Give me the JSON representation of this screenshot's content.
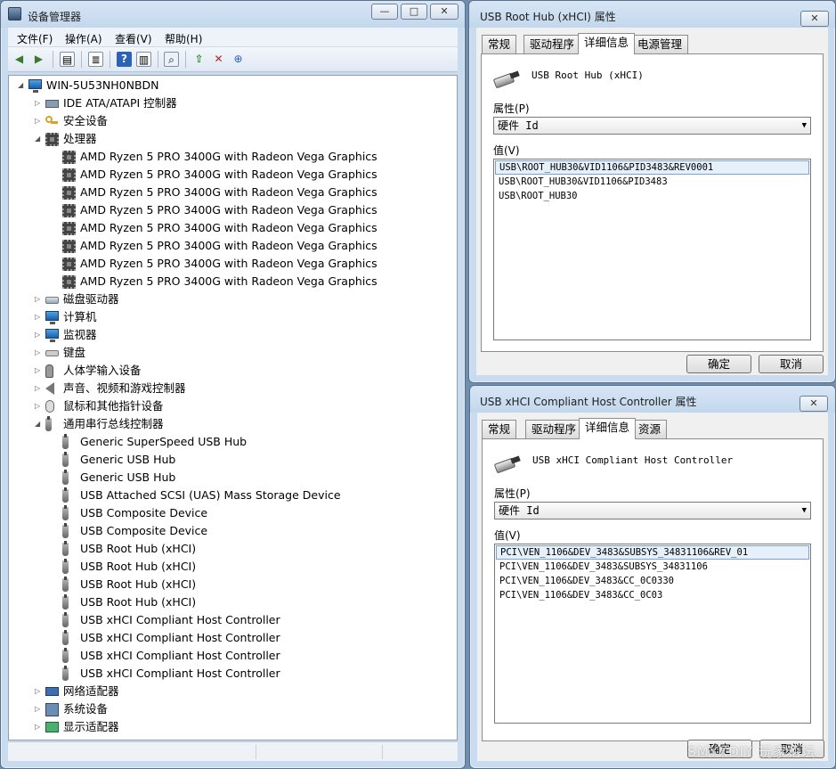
{
  "device_manager": {
    "title": "设备管理器",
    "caption_buttons": {
      "minimize": "—",
      "maximize": "□",
      "close": "✕"
    },
    "menu": [
      "文件(F)",
      "操作(A)",
      "查看(V)",
      "帮助(H)"
    ],
    "toolbar_icons": [
      "back-arrow-icon",
      "forward-arrow-icon",
      "show-hide-tree-icon",
      "properties-icon",
      "help-icon",
      "action-pane-icon",
      "scan-hardware-icon",
      "update-driver-icon",
      "uninstall-icon",
      "enable-device-icon"
    ],
    "tree": {
      "root": "WIN-5U53NH0NBDN",
      "categories": [
        {
          "label": "IDE ATA/ATAPI 控制器",
          "icon": "ide-controller-icon",
          "expanded": false,
          "children": []
        },
        {
          "label": "安全设备",
          "icon": "security-key-icon",
          "expanded": false,
          "children": []
        },
        {
          "label": "处理器",
          "icon": "processor-icon",
          "expanded": true,
          "children": [
            "AMD Ryzen 5 PRO 3400G with Radeon Vega Graphics",
            "AMD Ryzen 5 PRO 3400G with Radeon Vega Graphics",
            "AMD Ryzen 5 PRO 3400G with Radeon Vega Graphics",
            "AMD Ryzen 5 PRO 3400G with Radeon Vega Graphics",
            "AMD Ryzen 5 PRO 3400G with Radeon Vega Graphics",
            "AMD Ryzen 5 PRO 3400G with Radeon Vega Graphics",
            "AMD Ryzen 5 PRO 3400G with Radeon Vega Graphics",
            "AMD Ryzen 5 PRO 3400G with Radeon Vega Graphics"
          ]
        },
        {
          "label": "磁盘驱动器",
          "icon": "disk-drive-icon",
          "expanded": false,
          "children": []
        },
        {
          "label": "计算机",
          "icon": "computer-icon",
          "expanded": false,
          "children": []
        },
        {
          "label": "监视器",
          "icon": "monitor-icon",
          "expanded": false,
          "children": []
        },
        {
          "label": "键盘",
          "icon": "keyboard-icon",
          "expanded": false,
          "children": []
        },
        {
          "label": "人体学输入设备",
          "icon": "hid-icon",
          "expanded": false,
          "children": []
        },
        {
          "label": "声音、视频和游戏控制器",
          "icon": "speaker-icon",
          "expanded": false,
          "children": []
        },
        {
          "label": "鼠标和其他指针设备",
          "icon": "mouse-icon",
          "expanded": false,
          "children": []
        },
        {
          "label": "通用串行总线控制器",
          "icon": "usb-icon",
          "expanded": true,
          "children": [
            "Generic SuperSpeed USB Hub",
            "Generic USB Hub",
            "Generic USB Hub",
            "USB Attached SCSI (UAS) Mass Storage Device",
            "USB Composite Device",
            "USB Composite Device",
            "USB Root Hub (xHCI)",
            "USB Root Hub (xHCI)",
            "USB Root Hub (xHCI)",
            "USB Root Hub (xHCI)",
            "USB xHCI Compliant Host Controller",
            "USB xHCI Compliant Host Controller",
            "USB xHCI Compliant Host Controller",
            "USB xHCI Compliant Host Controller"
          ]
        },
        {
          "label": "网络适配器",
          "icon": "network-adapter-icon",
          "expanded": false,
          "children": []
        },
        {
          "label": "系统设备",
          "icon": "system-device-icon",
          "expanded": false,
          "children": []
        },
        {
          "label": "显示适配器",
          "icon": "display-adapter-icon",
          "expanded": false,
          "children": []
        }
      ]
    }
  },
  "dialog_root_hub": {
    "title": "USB Root Hub (xHCI) 属性",
    "close": "✕",
    "tabs": [
      "常规",
      "驱动程序",
      "详细信息",
      "电源管理"
    ],
    "active_tab": "详细信息",
    "device_name": "USB Root Hub (xHCI)",
    "property_label": "属性(P)",
    "property_value": "硬件 Id",
    "value_label": "值(V)",
    "values": [
      "USB\\ROOT_HUB30&VID1106&PID3483&REV0001",
      "USB\\ROOT_HUB30&VID1106&PID3483",
      "USB\\ROOT_HUB30"
    ],
    "selected_index": 0,
    "ok": "确定",
    "cancel": "取消"
  },
  "dialog_host_controller": {
    "title": "USB xHCI Compliant Host Controller 属性",
    "close": "✕",
    "tabs": [
      "常规",
      "驱动程序",
      "详细信息",
      "资源"
    ],
    "active_tab": "详细信息",
    "device_name": "USB xHCI Compliant Host Controller",
    "property_label": "属性(P)",
    "property_value": "硬件 Id",
    "value_label": "值(V)",
    "values": [
      "PCI\\VEN_1106&DEV_3483&SUBSYS_34831106&REV_01",
      "PCI\\VEN_1106&DEV_3483&SUBSYS_34831106",
      "PCI\\VEN_1106&DEV_3483&CC_0C0330",
      "PCI\\VEN_1106&DEV_3483&CC_0C03"
    ],
    "selected_index": 0,
    "ok": "确定",
    "cancel": "取消"
  },
  "watermark": "SMYXDIY 玩家论坛"
}
